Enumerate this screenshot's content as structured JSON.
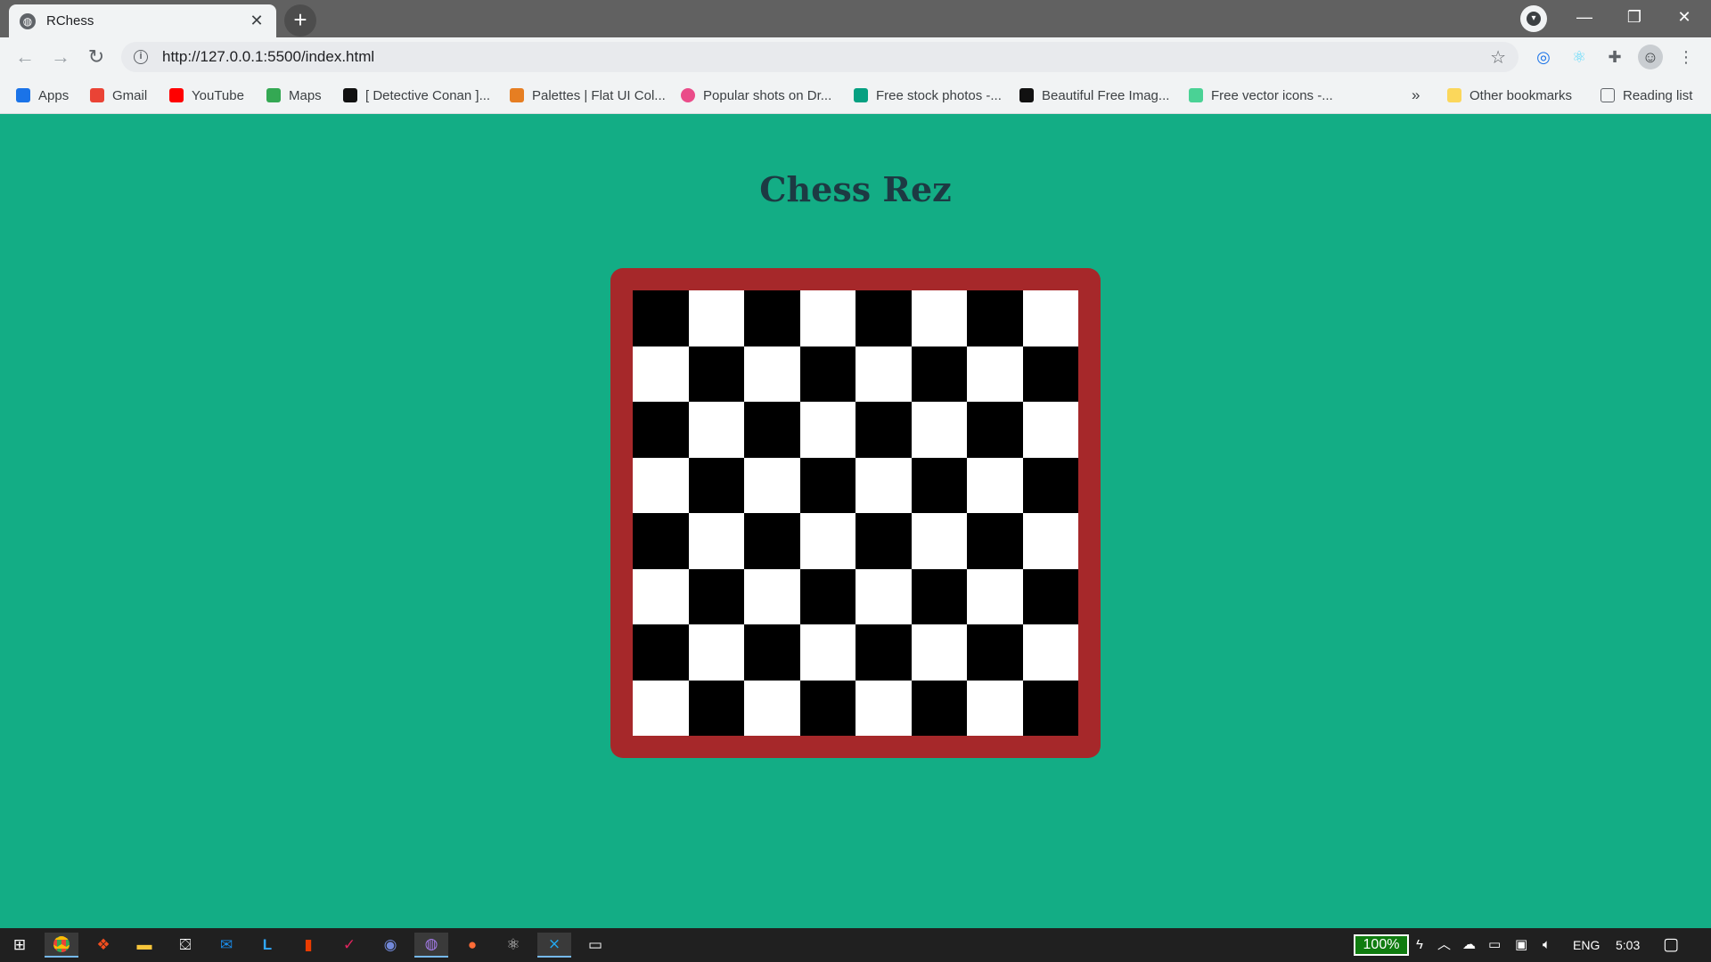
{
  "browser": {
    "tab": {
      "title": "RChess",
      "close_label": "✕"
    },
    "new_tab_label": "+",
    "window_controls": {
      "minimize": "—",
      "restore": "❐",
      "close": "✕"
    },
    "url": "http://127.0.0.1:5500/index.html",
    "bookmarks": [
      {
        "label": "Apps",
        "icon": "apps-grid-icon",
        "color": "#1a73e8"
      },
      {
        "label": "Gmail",
        "icon": "gmail-icon",
        "color": "#ea4335"
      },
      {
        "label": "YouTube",
        "icon": "youtube-icon",
        "color": "#ff0000"
      },
      {
        "label": "Maps",
        "icon": "maps-pin-icon",
        "color": "#34a853"
      },
      {
        "label": "[ Detective Conan ]...",
        "icon": "detective-conan-icon",
        "color": "#111111"
      },
      {
        "label": "Palettes | Flat UI Col...",
        "icon": "flat-ui-palette-icon",
        "color": "#e67e22"
      },
      {
        "label": "Popular shots on Dr...",
        "icon": "dribbble-icon",
        "color": "#ea4c89"
      },
      {
        "label": "Free stock photos -...",
        "icon": "pexels-icon",
        "color": "#05a081"
      },
      {
        "label": "Beautiful Free Imag...",
        "icon": "unsplash-icon",
        "color": "#111111"
      },
      {
        "label": "Free vector icons -...",
        "icon": "flaticon-icon",
        "color": "#4ad295"
      }
    ],
    "bookmarks_overflow": "»",
    "other_bookmarks": "Other bookmarks",
    "reading_list": "Reading list"
  },
  "page": {
    "title": "Chess Rez",
    "background": "#13ad85",
    "board": {
      "rows": 8,
      "cols": 8,
      "frame_color": "#a6282a",
      "light_color": "#ffffff",
      "dark_color": "#000000",
      "top_left": "black"
    }
  },
  "taskbar": {
    "battery": "100%",
    "language": "ENG",
    "time": "5:03",
    "apps": [
      "windows-start-icon",
      "chrome-icon",
      "figma-icon",
      "file-explorer-icon",
      "microsoft-store-icon",
      "mail-icon",
      "lightroom-icon",
      "office-icon",
      "vectr-icon",
      "discord-icon",
      "github-desktop-icon",
      "postman-icon",
      "atom-icon",
      "vscode-icon",
      "terminal-icon"
    ]
  }
}
